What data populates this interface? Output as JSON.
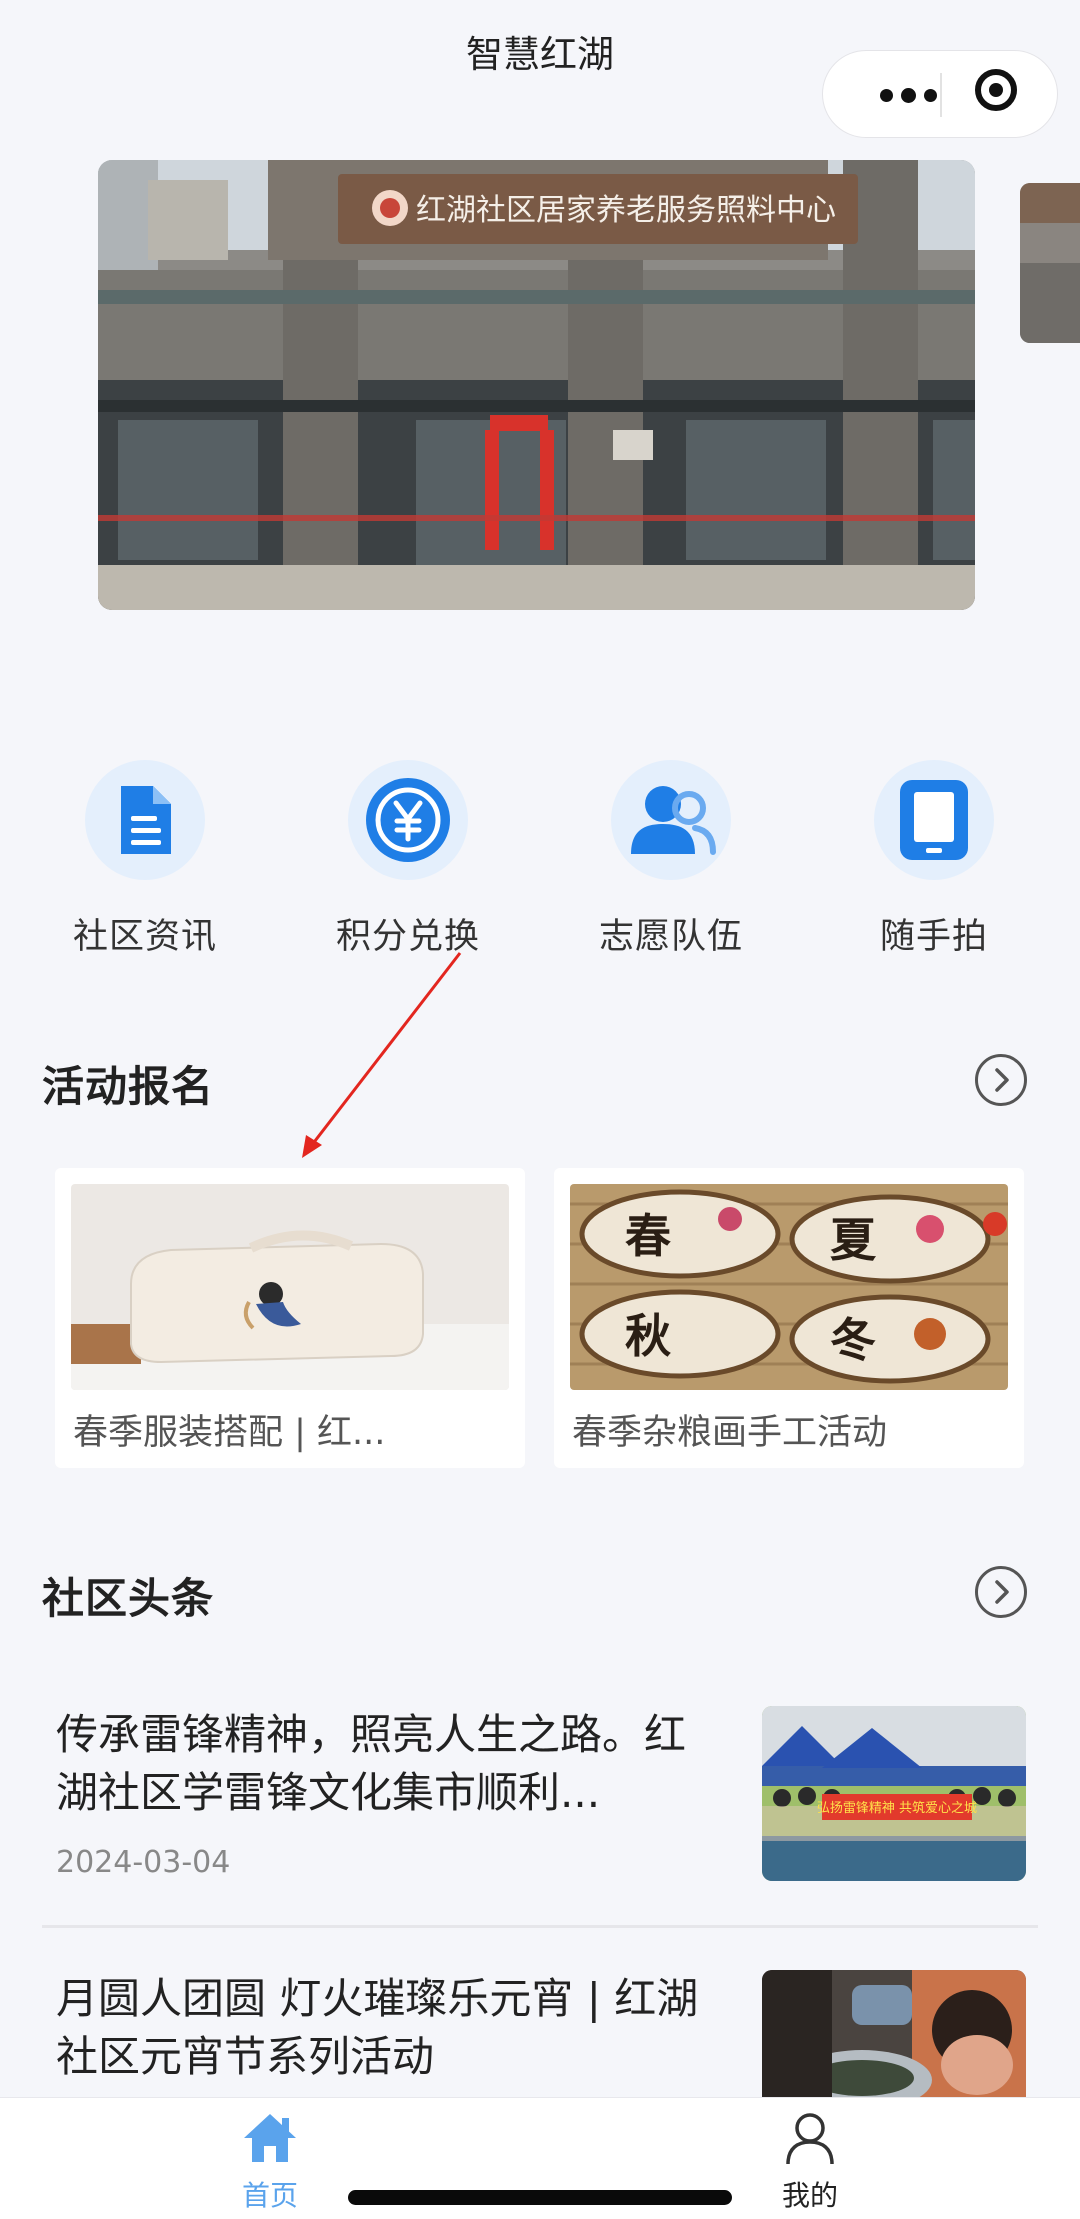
{
  "nav": {
    "title": "智慧红湖"
  },
  "banner": {
    "sign_text": "红湖社区居家养老服务照料中心"
  },
  "quick_links": [
    {
      "label": "社区资讯",
      "icon": "document-icon"
    },
    {
      "label": "积分兑换",
      "icon": "yuan-coin-icon"
    },
    {
      "label": "志愿队伍",
      "icon": "volunteers-icon"
    },
    {
      "label": "随手拍",
      "icon": "tablet-icon"
    }
  ],
  "activity": {
    "title": "活动报名",
    "cards": [
      {
        "caption": "春季服装搭配 | 红..."
      },
      {
        "caption": "春季杂粮画手工活动",
        "image_text": [
          "春",
          "夏",
          "秋",
          "冬"
        ]
      }
    ]
  },
  "news": {
    "title": "社区头条",
    "items": [
      {
        "title": "传承雷锋精神，照亮人生之路。红湖社区学雷锋文化集市顺利...",
        "date": "2024-03-04",
        "thumb_banner": "弘扬雷锋精神 共筑爱心之城"
      },
      {
        "title": "月圆人团圆 灯火璀璨乐元宵 | 红湖社区元宵节系列活动"
      }
    ]
  },
  "tabbar": {
    "items": [
      {
        "label": "首页",
        "icon": "home-icon",
        "active": true
      },
      {
        "label": "我的",
        "icon": "user-icon",
        "active": false
      }
    ],
    "active_color": "#5aa3ec"
  }
}
